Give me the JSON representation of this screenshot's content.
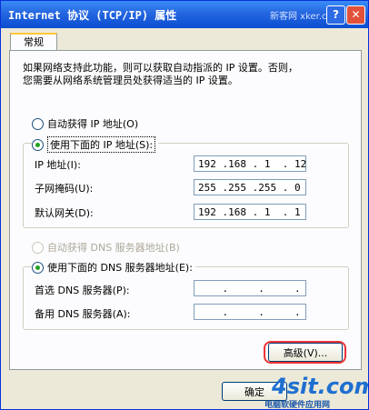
{
  "window": {
    "title": "Internet 协议 (TCP/IP) 属性",
    "watermark_top": "新客网 xker.com",
    "help_glyph": "?",
    "close_glyph": "✕"
  },
  "tabs": [
    {
      "label": "常规"
    }
  ],
  "intro": {
    "line1": "如果网络支持此功能，则可以获取自动指派的 IP 设置。否则，",
    "line2": "您需要从网络系统管理员处获得适当的 IP 设置。"
  },
  "ip": {
    "auto_label": "自动获得 IP 地址(O)",
    "manual_label": "使用下面的 IP 地址(S):",
    "auto_selected": false,
    "manual_selected": true,
    "address_label": "IP 地址(I):",
    "address_value": "192 .168 . 1  . 12",
    "mask_label": "子网掩码(U):",
    "mask_value": "255 .255 .255 . 0",
    "gateway_label": "默认网关(D):",
    "gateway_value": "192 .168 . 1  . 1"
  },
  "dns": {
    "auto_label": "自动获得 DNS 服务器地址(B)",
    "auto_disabled": true,
    "manual_label": "使用下面的 DNS 服务器地址(E):",
    "manual_selected": true,
    "preferred_label": "首选 DNS 服务器(P):",
    "preferred_value": "    .     .     .",
    "alternate_label": "备用 DNS 服务器(A):",
    "alternate_value": "    .     .     ."
  },
  "buttons": {
    "advanced": "高级(V)...",
    "ok": "确定"
  },
  "watermark_bottom": {
    "brand": "4sit.com",
    "sub": "电脑软硬件应用网"
  },
  "colors": {
    "titlebar": "#0a4ed1",
    "highlight": "#e33333",
    "radio_dot": "#21a121"
  }
}
